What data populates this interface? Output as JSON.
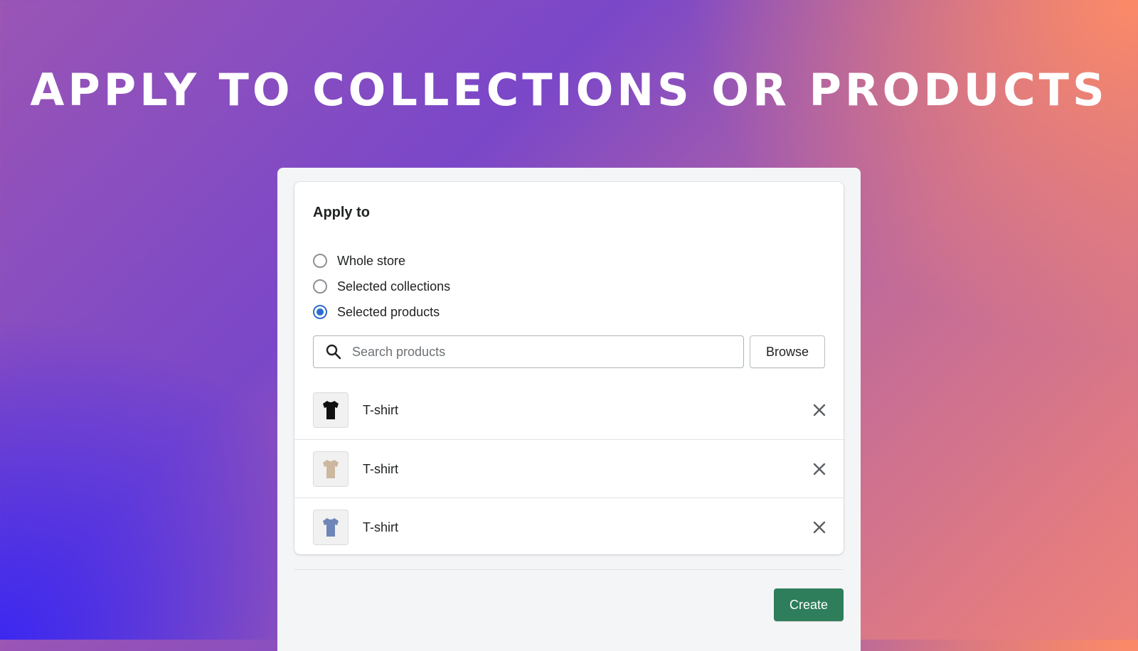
{
  "headline": "APPLY TO COLLECTIONS OR PRODUCTS",
  "card": {
    "title": "Apply to",
    "options": [
      {
        "label": "Whole store",
        "checked": false
      },
      {
        "label": "Selected collections",
        "checked": false
      },
      {
        "label": "Selected products",
        "checked": true
      }
    ],
    "search": {
      "placeholder": "Search products",
      "value": "",
      "icon": "search-icon"
    },
    "browse_label": "Browse",
    "products": [
      {
        "name": "T-shirt",
        "shirt_color": "#111111",
        "icon": "close-icon"
      },
      {
        "name": "T-shirt",
        "shirt_color": "#cbb89e",
        "icon": "close-icon"
      },
      {
        "name": "T-shirt",
        "shirt_color": "#6f86b8",
        "icon": "close-icon"
      }
    ]
  },
  "footer": {
    "create_label": "Create"
  },
  "colors": {
    "accent": "#2c6ecb",
    "primary_button": "#2e7d5b"
  }
}
